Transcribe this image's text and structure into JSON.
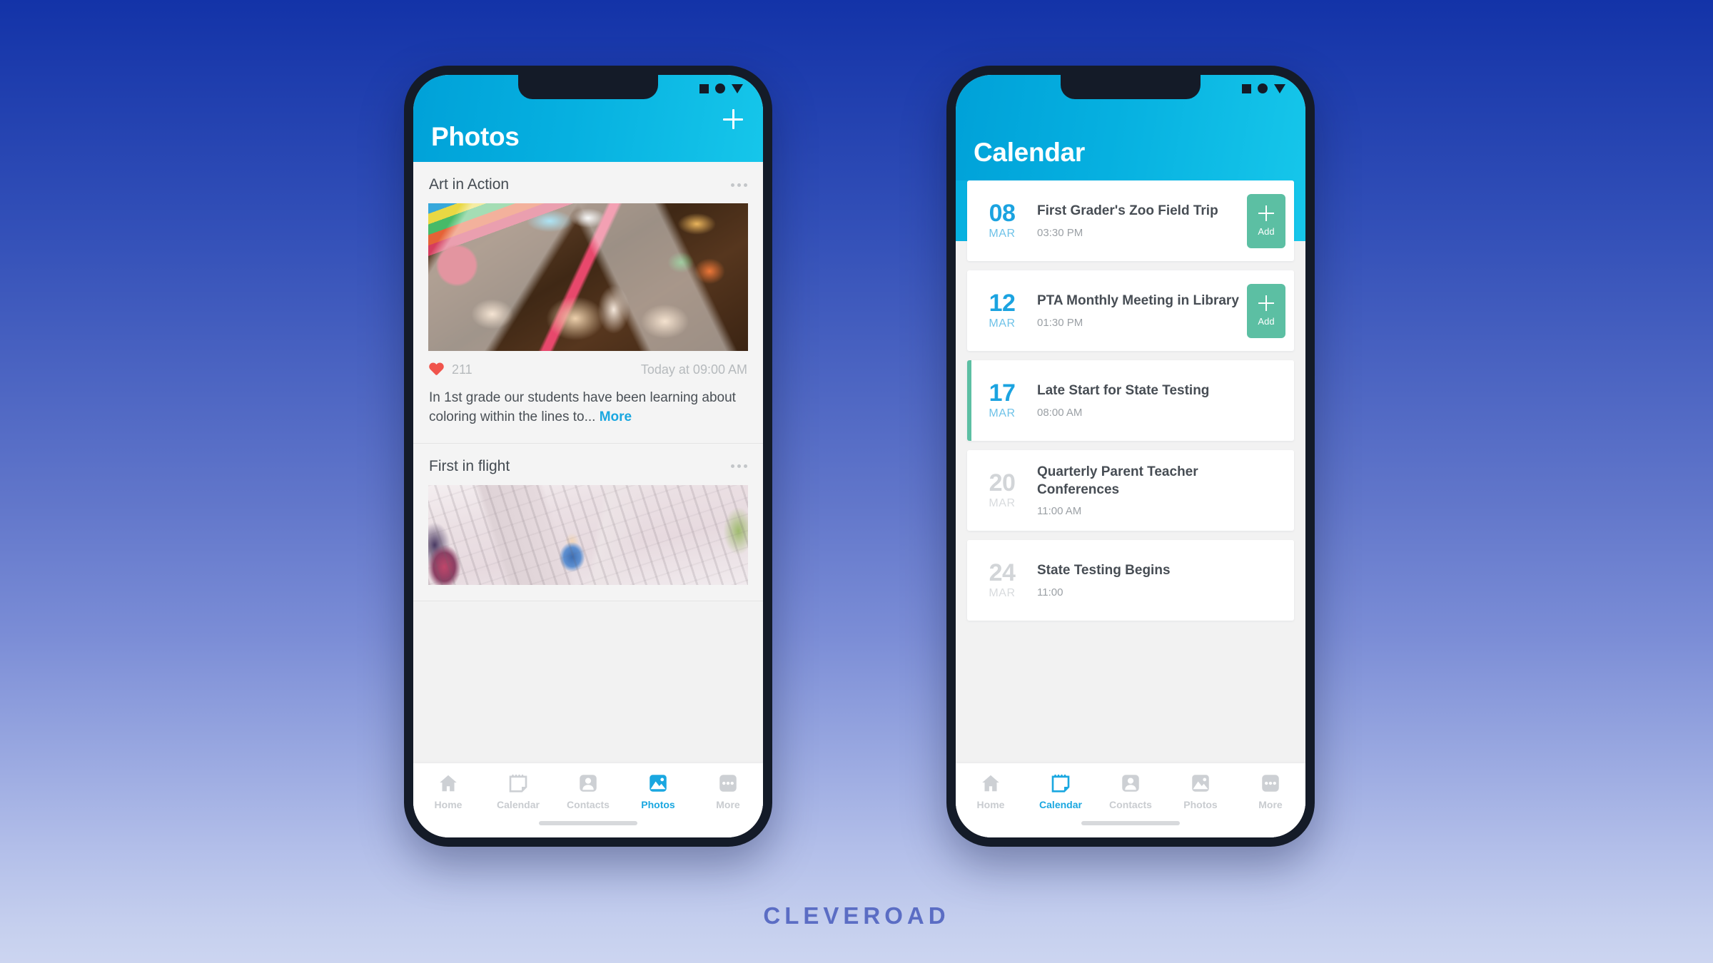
{
  "brand": "CLEVEROAD",
  "status_bar": {
    "icons": [
      "square-icon",
      "circle-icon",
      "triangle-down-icon"
    ]
  },
  "phones": {
    "left": {
      "header": {
        "title": "Photos",
        "add_label": "+"
      },
      "posts": [
        {
          "title": "Art in Action",
          "menu": "more-options",
          "likes": "211",
          "timestamp": "Today at 09:00 AM",
          "caption": "In 1st grade our students have been learning about coloring within the lines to... ",
          "more_label": "More"
        },
        {
          "title": "First in flight",
          "menu": "more-options"
        }
      ],
      "tabs": [
        {
          "label": "Home",
          "icon": "home-icon",
          "active": false
        },
        {
          "label": "Calendar",
          "icon": "calendar-icon",
          "active": false
        },
        {
          "label": "Contacts",
          "icon": "contacts-icon",
          "active": false
        },
        {
          "label": "Photos",
          "icon": "photos-icon",
          "active": true
        },
        {
          "label": "More",
          "icon": "more-icon",
          "active": false
        }
      ]
    },
    "right": {
      "header": {
        "title": "Calendar"
      },
      "events": [
        {
          "day": "08",
          "month": "MAR",
          "title": "First Grader's Zoo Field Trip",
          "time": "03:30 PM",
          "add_label": "Add",
          "has_add": true,
          "accent": false,
          "muted": false
        },
        {
          "day": "12",
          "month": "MAR",
          "title": "PTA Monthly Meeting in Library",
          "time": "01:30 PM",
          "add_label": "Add",
          "has_add": true,
          "accent": false,
          "muted": false
        },
        {
          "day": "17",
          "month": "MAR",
          "title": "Late Start for State Testing",
          "time": "08:00 AM",
          "add_label": "",
          "has_add": false,
          "accent": true,
          "muted": false
        },
        {
          "day": "20",
          "month": "MAR",
          "title": "Quarterly Parent Teacher Conferences",
          "time": "11:00 AM",
          "add_label": "",
          "has_add": false,
          "accent": false,
          "muted": true
        },
        {
          "day": "24",
          "month": "MAR",
          "title": "State Testing Begins",
          "time": "11:00",
          "add_label": "",
          "has_add": false,
          "accent": false,
          "muted": true
        }
      ],
      "tabs": [
        {
          "label": "Home",
          "icon": "home-icon",
          "active": false
        },
        {
          "label": "Calendar",
          "icon": "calendar-icon",
          "active": true
        },
        {
          "label": "Contacts",
          "icon": "contacts-icon",
          "active": false
        },
        {
          "label": "Photos",
          "icon": "photos-icon",
          "active": false
        },
        {
          "label": "More",
          "icon": "more-icon",
          "active": false
        }
      ]
    }
  },
  "colors": {
    "header_cyan": "#06b0e0",
    "accent_blue": "#1aa7e0",
    "add_green": "#5cbfa3",
    "heart_red": "#f0544c",
    "bg_top": "#1333a8",
    "bg_bottom": "#ccd5f0"
  }
}
